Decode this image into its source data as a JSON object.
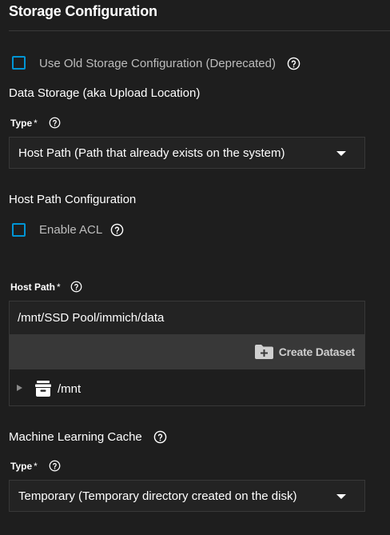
{
  "section": {
    "title": "Storage Configuration"
  },
  "old_storage": {
    "label": "Use Old Storage Configuration (Deprecated)",
    "checked": false
  },
  "data_storage": {
    "heading": "Data Storage (aka Upload Location)",
    "type_label": "Type",
    "required_mark": "*",
    "selected": "Host Path (Path that already exists on the system)"
  },
  "host_path_config": {
    "heading": "Host Path Configuration",
    "acl_label": "Enable ACL",
    "acl_checked": false,
    "host_path_label": "Host Path",
    "required_mark": "*",
    "host_path_value": "/mnt/SSD Pool/immich/data",
    "create_dataset_label": "Create Dataset",
    "tree_root": "/mnt"
  },
  "ml_cache": {
    "heading": "Machine Learning Cache",
    "type_label": "Type",
    "required_mark": "*",
    "selected": "Temporary (Temporary directory created on the disk)"
  },
  "colors": {
    "background": "#1e1e1e",
    "checkbox_border": "#0095d5",
    "toolbar": "#383838",
    "muted_text": "#bdbdbd"
  }
}
